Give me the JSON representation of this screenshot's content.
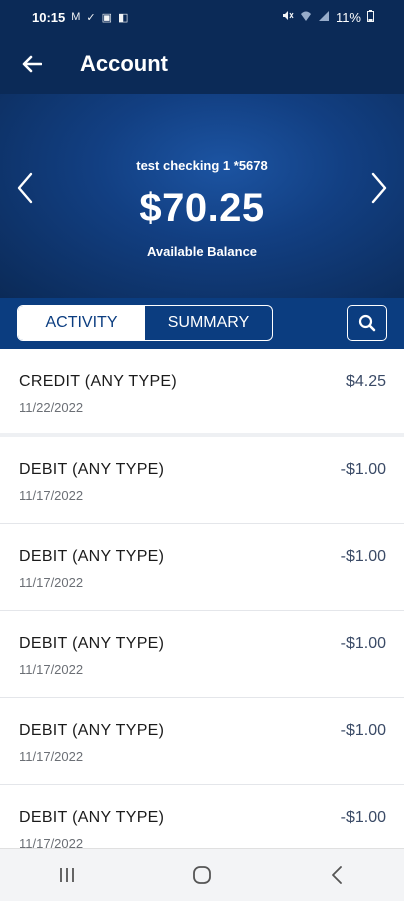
{
  "status_bar": {
    "time": "10:15",
    "left_icons": [
      "M",
      "✓",
      "▣",
      "◧"
    ],
    "battery": "11%"
  },
  "app_bar": {
    "title": "Account"
  },
  "account": {
    "name": "test checking 1 *5678",
    "balance": "$70.25",
    "balance_label": "Available Balance"
  },
  "tabs": [
    {
      "label": "ACTIVITY",
      "active": true
    },
    {
      "label": "SUMMARY",
      "active": false
    }
  ],
  "transactions": [
    {
      "title": "CREDIT (ANY TYPE)",
      "date": "11/22/2022",
      "amount": "$4.25"
    },
    {
      "title": "DEBIT (ANY TYPE)",
      "date": "11/17/2022",
      "amount": "-$1.00"
    },
    {
      "title": "DEBIT (ANY TYPE)",
      "date": "11/17/2022",
      "amount": "-$1.00"
    },
    {
      "title": "DEBIT (ANY TYPE)",
      "date": "11/17/2022",
      "amount": "-$1.00"
    },
    {
      "title": "DEBIT (ANY TYPE)",
      "date": "11/17/2022",
      "amount": "-$1.00"
    },
    {
      "title": "DEBIT (ANY TYPE)",
      "date": "11/17/2022",
      "amount": "-$1.00"
    }
  ],
  "icons": {
    "back": "arrow-left-icon",
    "prev": "chevron-left-icon",
    "next": "chevron-right-icon",
    "search": "search-icon",
    "nav_recents": "recents-icon",
    "nav_home": "home-icon",
    "nav_back": "back-icon"
  },
  "colors": {
    "header": "#0b2a57",
    "tabs_bg": "#0b3d80",
    "accent": "#1c54a2"
  }
}
